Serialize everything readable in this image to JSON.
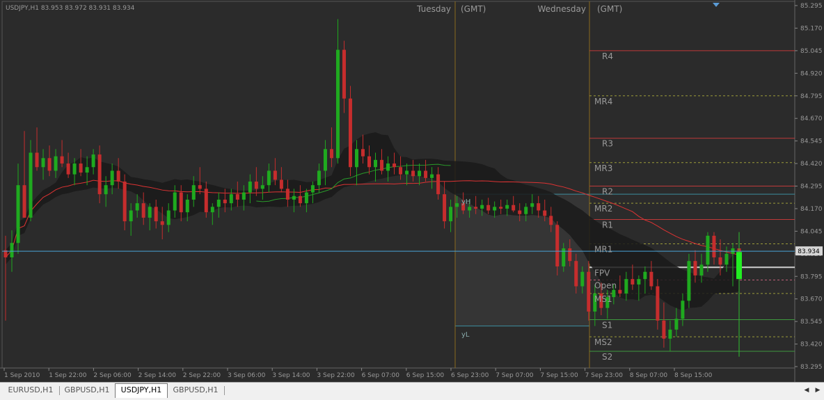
{
  "header": {
    "symbol_info": "USDJPY,H1  83.953 83.972 83.931 83.934"
  },
  "sessions": [
    {
      "day": "Tuesday",
      "tz": "(GMT)"
    },
    {
      "day": "Wednesday",
      "tz": "(GMT)"
    }
  ],
  "pivot_labels": [
    "R4",
    "MR4",
    "R3",
    "MR3",
    "R2",
    "MR2",
    "R1",
    "MR1",
    "FPV",
    "Open",
    "MS1",
    "S1",
    "MS2",
    "S2"
  ],
  "range_labels": {
    "high": "yH",
    "low": "yL"
  },
  "current_price_label": "83.934",
  "colors": {
    "background": "#2b2b2b",
    "bull": "#1faa1f",
    "bear": "#c62d2d",
    "axis": "#888888",
    "resistance": "#c03a3a",
    "support": "#3f9a3f",
    "mid_levels": "#9c9c3a",
    "range_box": "#3c8ea0",
    "session": "#8a6a1e",
    "bid_line": "#4aa3d6"
  },
  "chart_data": {
    "type": "candlestick",
    "symbol": "USDJPY",
    "timeframe": "H1",
    "ylim": [
      83.295,
      85.295
    ],
    "y_ticks": [
      "85.295",
      "85.170",
      "85.045",
      "84.920",
      "84.795",
      "84.670",
      "84.545",
      "84.420",
      "84.295",
      "84.170",
      "84.045",
      "83.920",
      "83.795",
      "83.670",
      "83.545",
      "83.420",
      "83.295"
    ],
    "x_ticks": [
      "1 Sep 2010",
      "1 Sep 22:00",
      "2 Sep 06:00",
      "2 Sep 14:00",
      "2 Sep 22:00",
      "3 Sep 06:00",
      "3 Sep 14:00",
      "3 Sep 22:00",
      "6 Sep 07:00",
      "6 Sep 15:00",
      "6 Sep 23:00",
      "7 Sep 07:00",
      "7 Sep 15:00",
      "7 Sep 23:00",
      "8 Sep 07:00",
      "8 Sep 15:00"
    ],
    "last_price": 83.934,
    "pivot_levels": [
      {
        "name": "R4",
        "value": 85.045,
        "kind": "resistance"
      },
      {
        "name": "MR4",
        "value": 84.795,
        "kind": "mid"
      },
      {
        "name": "R3",
        "value": 84.56,
        "kind": "resistance"
      },
      {
        "name": "MR3",
        "value": 84.425,
        "kind": "mid"
      },
      {
        "name": "R2",
        "value": 84.295,
        "kind": "resistance"
      },
      {
        "name": "MR2",
        "value": 84.2,
        "kind": "mid"
      },
      {
        "name": "R1",
        "value": 84.11,
        "kind": "resistance"
      },
      {
        "name": "MR1",
        "value": 83.975,
        "kind": "mid"
      },
      {
        "name": "FPV",
        "value": 83.845,
        "kind": "pivot"
      },
      {
        "name": "Open",
        "value": 83.775,
        "kind": "open"
      },
      {
        "name": "MS1",
        "value": 83.7,
        "kind": "mid"
      },
      {
        "name": "S1",
        "value": 83.555,
        "kind": "support"
      },
      {
        "name": "MS2",
        "value": 83.46,
        "kind": "mid"
      },
      {
        "name": "S2",
        "value": 83.38,
        "kind": "support"
      }
    ],
    "yesterday_range": {
      "high": 84.25,
      "low": 83.52
    },
    "candles": [
      [
        83.94,
        84.02,
        83.55,
        83.9
      ],
      [
        83.9,
        84.05,
        83.82,
        83.98
      ],
      [
        83.98,
        84.42,
        83.92,
        84.3
      ],
      [
        84.3,
        84.6,
        84.12,
        84.12
      ],
      [
        84.12,
        84.55,
        84.1,
        84.48
      ],
      [
        84.48,
        84.62,
        84.38,
        84.4
      ],
      [
        84.4,
        84.5,
        84.33,
        84.45
      ],
      [
        84.45,
        84.52,
        84.35,
        84.38
      ],
      [
        84.38,
        84.5,
        84.34,
        84.46
      ],
      [
        84.46,
        84.55,
        84.4,
        84.42
      ],
      [
        84.42,
        84.48,
        84.34,
        84.36
      ],
      [
        84.36,
        84.45,
        84.3,
        84.42
      ],
      [
        84.42,
        84.5,
        84.35,
        84.37
      ],
      [
        84.37,
        84.46,
        84.3,
        84.4
      ],
      [
        84.4,
        84.5,
        84.36,
        84.47
      ],
      [
        84.47,
        84.52,
        84.2,
        84.25
      ],
      [
        84.25,
        84.35,
        84.18,
        84.3
      ],
      [
        84.3,
        84.42,
        84.25,
        84.38
      ],
      [
        84.38,
        84.45,
        84.28,
        84.32
      ],
      [
        84.32,
        84.36,
        84.05,
        84.1
      ],
      [
        84.1,
        84.2,
        84.02,
        84.16
      ],
      [
        84.16,
        84.25,
        84.12,
        84.2
      ],
      [
        84.2,
        84.26,
        84.08,
        84.12
      ],
      [
        84.12,
        84.2,
        84.05,
        84.18
      ],
      [
        84.18,
        84.22,
        84.06,
        84.1
      ],
      [
        84.1,
        84.18,
        84.0,
        84.08
      ],
      [
        84.08,
        84.2,
        84.04,
        84.16
      ],
      [
        84.16,
        84.3,
        84.12,
        84.26
      ],
      [
        84.26,
        84.3,
        84.1,
        84.15
      ],
      [
        84.15,
        84.25,
        84.1,
        84.22
      ],
      [
        84.22,
        84.35,
        84.18,
        84.3
      ],
      [
        84.3,
        84.4,
        84.25,
        84.28
      ],
      [
        84.28,
        84.32,
        84.12,
        84.15
      ],
      [
        84.15,
        84.2,
        84.08,
        84.18
      ],
      [
        84.18,
        84.26,
        84.12,
        84.22
      ],
      [
        84.22,
        84.28,
        84.15,
        84.2
      ],
      [
        84.2,
        84.28,
        84.16,
        84.25
      ],
      [
        84.25,
        84.32,
        84.18,
        84.22
      ],
      [
        84.22,
        84.3,
        84.16,
        84.26
      ],
      [
        84.26,
        84.36,
        84.2,
        84.32
      ],
      [
        84.32,
        84.4,
        84.24,
        84.28
      ],
      [
        84.28,
        84.35,
        84.22,
        84.3
      ],
      [
        84.3,
        84.42,
        84.26,
        84.38
      ],
      [
        84.38,
        84.45,
        84.3,
        84.33
      ],
      [
        84.33,
        84.4,
        84.26,
        84.28
      ],
      [
        84.28,
        84.33,
        84.18,
        84.22
      ],
      [
        84.22,
        84.28,
        84.15,
        84.24
      ],
      [
        84.24,
        84.3,
        84.18,
        84.2
      ],
      [
        84.2,
        84.28,
        84.15,
        84.26
      ],
      [
        84.26,
        84.32,
        84.2,
        84.3
      ],
      [
        84.3,
        84.42,
        84.26,
        84.38
      ],
      [
        84.38,
        84.55,
        84.3,
        84.5
      ],
      [
        84.5,
        84.62,
        84.4,
        84.45
      ],
      [
        84.45,
        85.22,
        84.42,
        85.05
      ],
      [
        85.05,
        85.1,
        84.7,
        84.78
      ],
      [
        84.78,
        84.85,
        84.35,
        84.4
      ],
      [
        84.4,
        84.55,
        84.3,
        84.5
      ],
      [
        84.5,
        84.58,
        84.42,
        84.46
      ],
      [
        84.46,
        84.52,
        84.36,
        84.4
      ],
      [
        84.4,
        84.48,
        84.32,
        84.44
      ],
      [
        84.44,
        84.5,
        84.36,
        84.38
      ],
      [
        84.38,
        84.46,
        84.32,
        84.42
      ],
      [
        84.42,
        84.48,
        84.36,
        84.4
      ],
      [
        84.4,
        84.46,
        84.33,
        84.36
      ],
      [
        84.36,
        84.42,
        84.3,
        84.38
      ],
      [
        84.38,
        84.44,
        84.32,
        84.35
      ],
      [
        84.35,
        84.42,
        84.3,
        84.38
      ],
      [
        84.38,
        84.44,
        84.32,
        84.34
      ],
      [
        84.34,
        84.4,
        84.28,
        84.36
      ],
      [
        84.36,
        84.4,
        84.22,
        84.25
      ],
      [
        84.25,
        84.32,
        84.06,
        84.1
      ],
      [
        84.1,
        84.22,
        84.04,
        84.18
      ],
      [
        84.18,
        84.24,
        84.12,
        84.2
      ],
      [
        84.2,
        84.26,
        84.14,
        84.16
      ],
      [
        84.16,
        84.22,
        84.12,
        84.18
      ],
      [
        84.18,
        84.24,
        84.14,
        84.17
      ],
      [
        84.17,
        84.22,
        84.13,
        84.19
      ],
      [
        84.19,
        84.23,
        84.14,
        84.16
      ],
      [
        84.16,
        84.21,
        84.12,
        84.18
      ],
      [
        84.18,
        84.22,
        84.14,
        84.17
      ],
      [
        84.17,
        84.22,
        84.13,
        84.19
      ],
      [
        84.19,
        84.24,
        84.15,
        84.16
      ],
      [
        84.16,
        84.2,
        84.1,
        84.14
      ],
      [
        84.14,
        84.2,
        84.1,
        84.18
      ],
      [
        84.18,
        84.25,
        84.14,
        84.2
      ],
      [
        84.2,
        84.24,
        84.12,
        84.16
      ],
      [
        84.16,
        84.22,
        84.1,
        84.13
      ],
      [
        84.13,
        84.18,
        84.04,
        84.08
      ],
      [
        84.08,
        84.1,
        83.8,
        83.85
      ],
      [
        83.85,
        83.98,
        83.82,
        83.95
      ],
      [
        83.95,
        84.0,
        83.85,
        83.88
      ],
      [
        83.88,
        83.92,
        83.7,
        83.74
      ],
      [
        83.74,
        83.85,
        83.7,
        83.82
      ],
      [
        83.82,
        83.88,
        83.55,
        83.6
      ],
      [
        83.6,
        83.75,
        83.52,
        83.7
      ],
      [
        83.7,
        83.76,
        83.58,
        83.62
      ],
      [
        83.62,
        83.72,
        83.56,
        83.68
      ],
      [
        83.68,
        83.75,
        83.64,
        83.72
      ],
      [
        83.72,
        83.8,
        83.68,
        83.7
      ],
      [
        83.7,
        83.82,
        83.66,
        83.78
      ],
      [
        83.78,
        83.86,
        83.72,
        83.75
      ],
      [
        83.75,
        83.8,
        83.66,
        83.78
      ],
      [
        83.78,
        83.85,
        83.7,
        83.82
      ],
      [
        83.82,
        83.88,
        83.72,
        83.74
      ],
      [
        83.74,
        83.78,
        83.5,
        83.55
      ],
      [
        83.55,
        83.65,
        83.4,
        83.45
      ],
      [
        83.45,
        83.55,
        83.38,
        83.5
      ],
      [
        83.5,
        83.62,
        83.46,
        83.56
      ],
      [
        83.56,
        83.7,
        83.52,
        83.66
      ],
      [
        83.66,
        83.92,
        83.62,
        83.88
      ],
      [
        83.88,
        83.94,
        83.76,
        83.8
      ],
      [
        83.8,
        83.92,
        83.76,
        83.86
      ],
      [
        83.86,
        84.04,
        83.82,
        84.02
      ],
      [
        84.02,
        84.04,
        83.86,
        83.9
      ],
      [
        83.9,
        84.0,
        83.8,
        83.86
      ],
      [
        83.86,
        83.96,
        83.82,
        83.92
      ],
      [
        83.92,
        83.98,
        83.74,
        83.95
      ],
      [
        83.95,
        83.96,
        83.9,
        83.93
      ]
    ]
  }
}
